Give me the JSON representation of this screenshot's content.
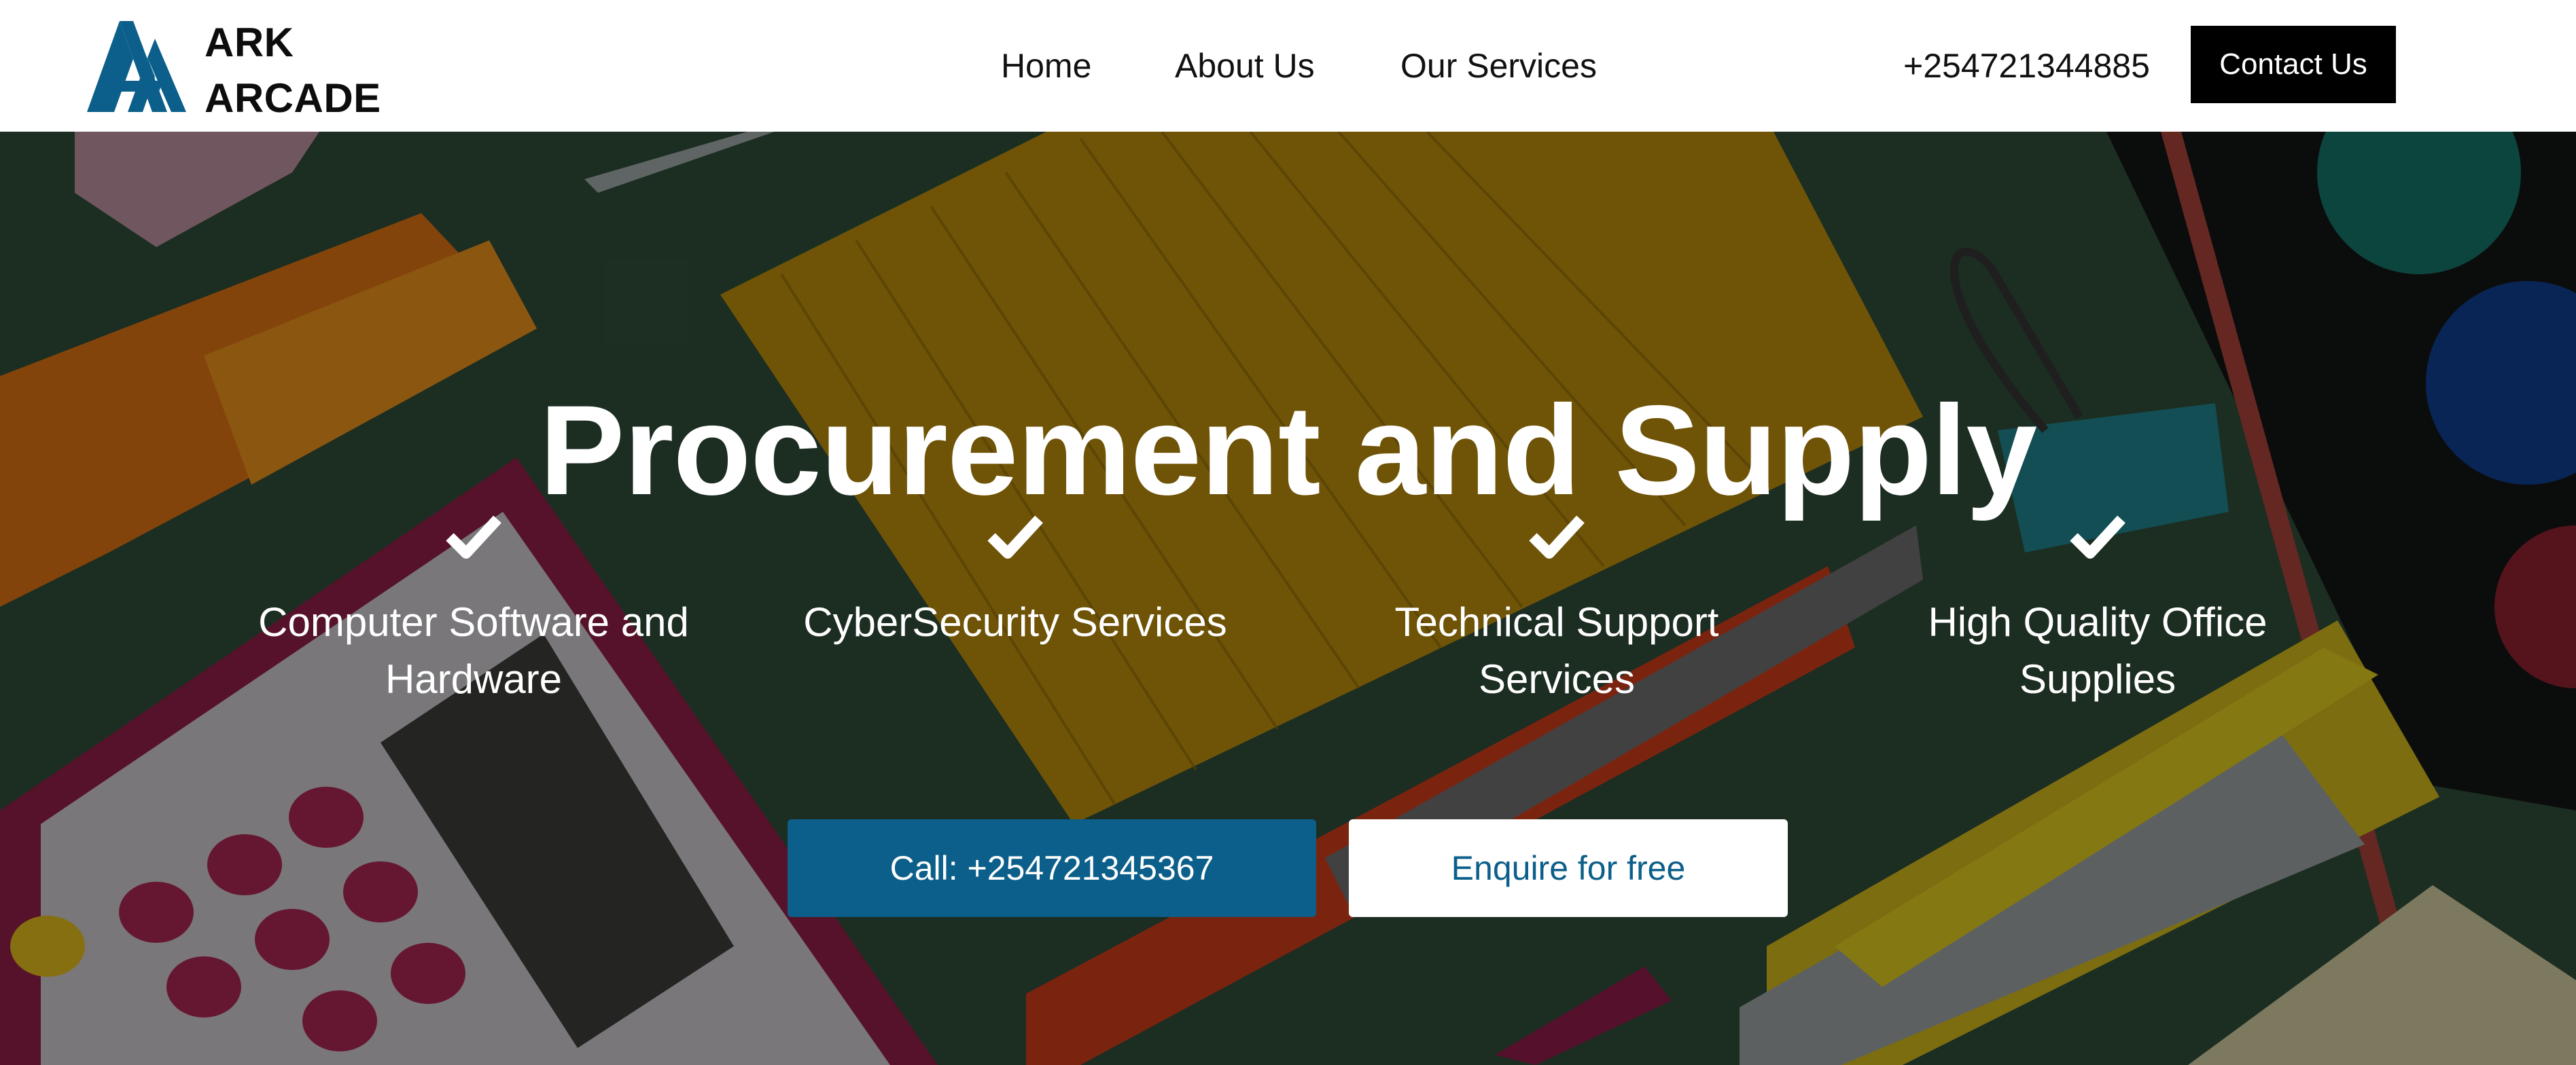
{
  "header": {
    "logo": {
      "line1": "ARK",
      "line2": "ARCADE",
      "color": "#0c5f8a"
    },
    "nav": [
      {
        "label": "Home"
      },
      {
        "label": "About Us"
      },
      {
        "label": "Our Services"
      }
    ],
    "phone": "+254721344885",
    "contact_button": "Contact Us"
  },
  "hero": {
    "title": "Procurement and Supply",
    "features": [
      {
        "label": "Computer Software and Hardware",
        "icon": "check-icon"
      },
      {
        "label": "CyberSecurity Services",
        "icon": "check-icon"
      },
      {
        "label": "Technical Support Services",
        "icon": "check-icon"
      },
      {
        "label": "High Quality Office Supplies",
        "icon": "check-icon"
      }
    ],
    "call_button": "Call: +254721345367",
    "enquire_button": "Enquire for free",
    "background_image": "office-supplies-background"
  },
  "colors": {
    "brand": "#0c5f8a",
    "header_bg": "#ffffff",
    "contact_button_bg": "#000000"
  }
}
